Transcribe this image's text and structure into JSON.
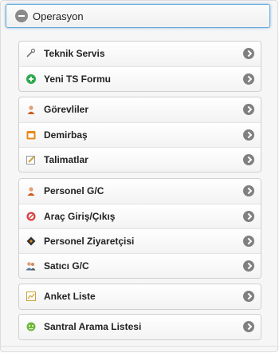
{
  "header": {
    "title": "Operasyon",
    "collapse_icon": "minus-circle-icon"
  },
  "groups": [
    {
      "items": [
        {
          "label": "Teknik Servis",
          "icon": "wrench-icon",
          "color": "#777777"
        },
        {
          "label": "Yeni TS Formu",
          "icon": "plus-circle-icon",
          "color": "#2fa84f"
        }
      ]
    },
    {
      "items": [
        {
          "label": "Görevliler",
          "icon": "user-icon",
          "color": "#d0591e"
        },
        {
          "label": "Demirbaş",
          "icon": "calendar-icon",
          "color": "#e8891c"
        },
        {
          "label": "Talimatlar",
          "icon": "edit-icon",
          "color": "#c9a23a"
        }
      ]
    },
    {
      "items": [
        {
          "label": "Personel G/C",
          "icon": "user-icon",
          "color": "#d0591e"
        },
        {
          "label": "Araç Giriş/Çıkış",
          "icon": "no-entry-icon",
          "color": "#d93a3a"
        },
        {
          "label": "Personel Ziyaretçisi",
          "icon": "diamond-icon",
          "color": "#333333"
        },
        {
          "label": "Satıcı G/C",
          "icon": "users-icon",
          "color": "#4a78a8"
        }
      ]
    },
    {
      "items": [
        {
          "label": "Anket Liste",
          "icon": "chart-icon",
          "color": "#c9a23a"
        }
      ]
    },
    {
      "items": [
        {
          "label": "Santral Arama Listesi",
          "icon": "phone-icon",
          "color": "#6fb83a"
        }
      ]
    }
  ]
}
